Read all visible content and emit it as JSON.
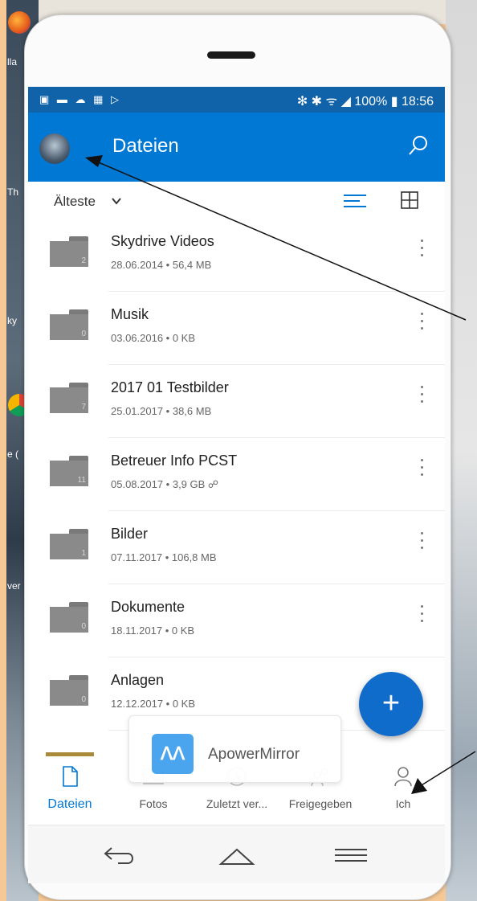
{
  "desktop": {
    "labels": [
      "lla",
      "Th",
      "ky",
      "e (",
      "ver"
    ]
  },
  "status_bar": {
    "left_icons": "▣ ▬ ☁ ▦ ▷",
    "right_text": "✻ ✱ ᯤ ◢ 100% ▮ 18:56"
  },
  "app_bar": {
    "title": "Dateien",
    "avatar_icon": "avatar",
    "search_icon": "search-icon"
  },
  "sort": {
    "label": "Älteste",
    "list_view_icon": "list-view-icon",
    "grid_view_icon": "grid-view-icon"
  },
  "files": [
    {
      "name": "Skydrive Videos",
      "meta": "28.06.2014 • 56,4 MB",
      "count": "2"
    },
    {
      "name": "Musik",
      "meta": "03.06.2016 • 0 KB",
      "count": "0"
    },
    {
      "name": "2017 01 Testbilder",
      "meta": "25.01.2017 • 38,6 MB",
      "count": "7"
    },
    {
      "name": "Betreuer Info PCST",
      "meta": "05.08.2017 • 3,9 GB ☍",
      "count": "11"
    },
    {
      "name": "Bilder",
      "meta": "07.11.2017 • 106,8 MB",
      "count": "1"
    },
    {
      "name": "Dokumente",
      "meta": "18.11.2017 • 0 KB",
      "count": "0"
    },
    {
      "name": "Anlagen",
      "meta": "12.12.2017 • 0 KB",
      "count": "0"
    }
  ],
  "fab": {
    "symbol": "+"
  },
  "popup": {
    "logo": "ꓥꓥ",
    "text": "ApowerMirror"
  },
  "bottom_nav": {
    "items": [
      {
        "label": "Dateien",
        "icon": "file-icon",
        "active": true
      },
      {
        "label": "Fotos",
        "icon": "photo-icon",
        "active": false
      },
      {
        "label": "Zuletzt ver...",
        "icon": "clock-icon",
        "active": false
      },
      {
        "label": "Freigegeben",
        "icon": "share-icon",
        "active": false
      },
      {
        "label": "Ich",
        "icon": "person-icon",
        "active": false
      }
    ]
  },
  "system_nav": {
    "back_icon": "back-icon",
    "home_icon": "home-icon",
    "menu_icon": "menu-icon"
  },
  "colors": {
    "accent": "#0078d4",
    "status_bar": "#1163a9",
    "fab": "#0f6ccb",
    "backdrop": "#f5c896"
  }
}
